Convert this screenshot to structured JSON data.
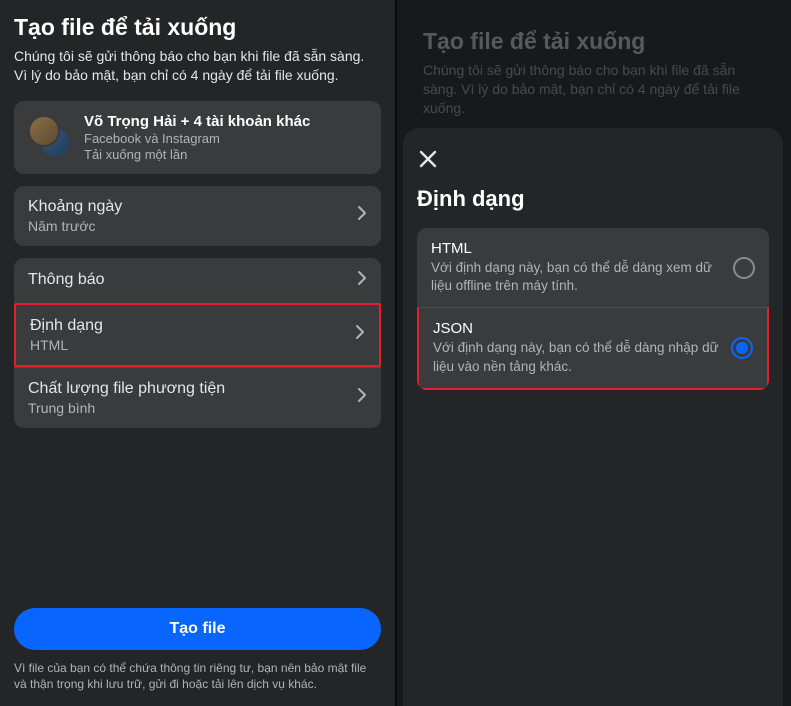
{
  "left": {
    "title": "Tạo file để tải xuống",
    "subtitle": "Chúng tôi sẽ gửi thông báo cho bạn khi file đã sẵn sàng. Vì lý do bảo mật, bạn chỉ có 4 ngày để tải file xuống.",
    "account": {
      "title": "Võ Trọng Hải + 4 tài khoản khác",
      "platforms": "Facebook và Instagram",
      "download_type": "Tải xuống một lần"
    },
    "date_range": {
      "label": "Khoảng ngày",
      "value": "Năm trước"
    },
    "notification": {
      "label": "Thông báo"
    },
    "format": {
      "label": "Định dạng",
      "value": "HTML"
    },
    "media_quality": {
      "label": "Chất lượng file phương tiện",
      "value": "Trung bình"
    },
    "create_button": "Tạo file",
    "footer": "Vì file của bạn có thể chứa thông tin riêng tư, bạn nên bảo mật file và thận trọng khi lưu trữ, gửi đi hoặc tải lên dịch vụ khác."
  },
  "right": {
    "bg_title": "Tạo file để tải xuống",
    "bg_subtitle": "Chúng tôi sẽ gửi thông báo cho bạn khi file đã sẵn sàng. Vì lý do bảo mật, bạn chỉ có 4 ngày để tải file xuống.",
    "sheet_title": "Định dạng",
    "option_html": {
      "title": "HTML",
      "desc": "Với định dạng này, bạn có thể dễ dàng xem dữ liệu offline trên máy tính."
    },
    "option_json": {
      "title": "JSON",
      "desc": "Với định dạng này, bạn có thể dễ dàng nhập dữ liệu vào nền tảng khác."
    }
  }
}
